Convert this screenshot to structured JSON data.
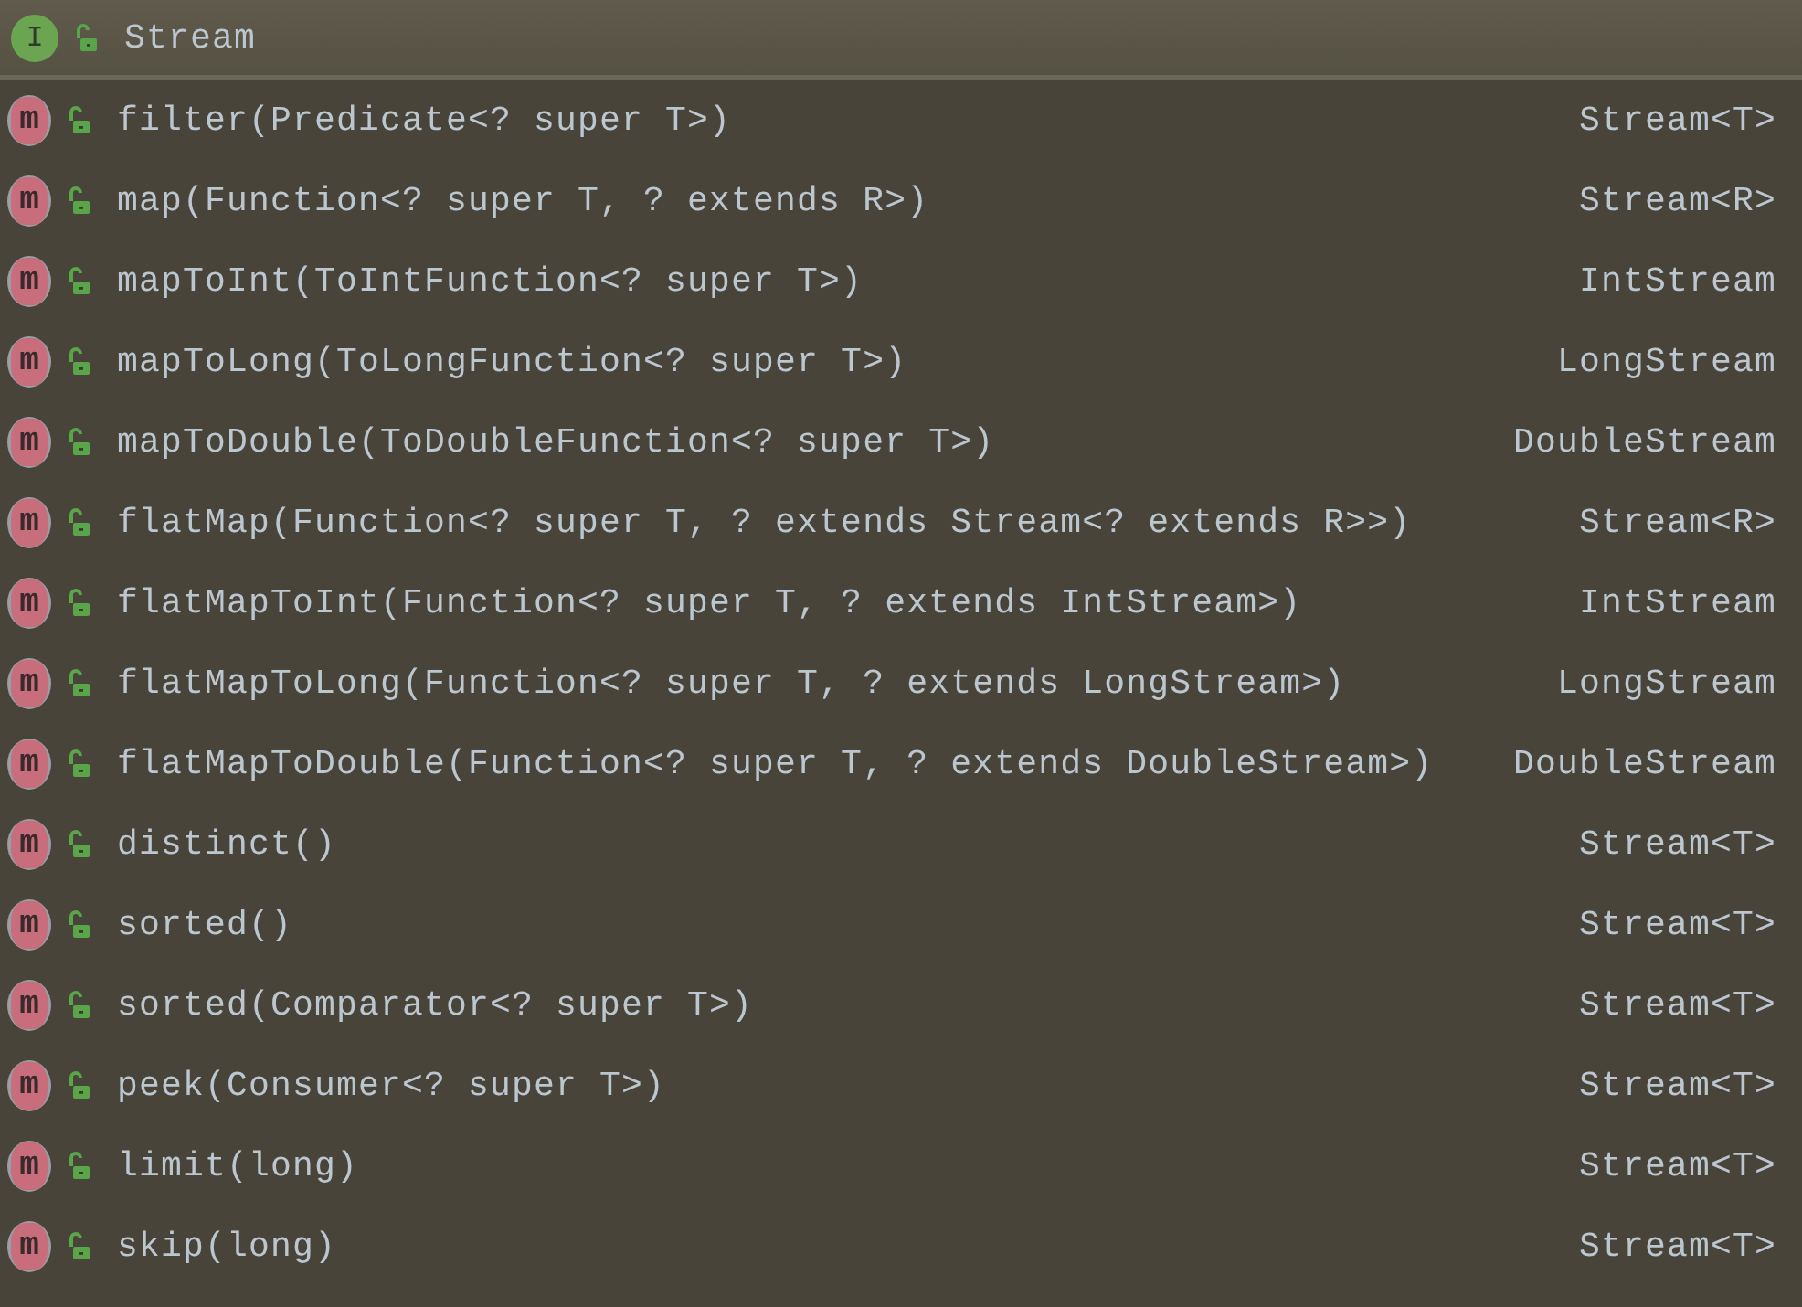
{
  "header": {
    "badge": "I",
    "title": "Stream"
  },
  "methods": [
    {
      "badge": "m",
      "signature": "filter(Predicate<? super T>)",
      "returns": "Stream<T>"
    },
    {
      "badge": "m",
      "signature": "map(Function<? super T, ? extends R>)",
      "returns": "Stream<R>"
    },
    {
      "badge": "m",
      "signature": "mapToInt(ToIntFunction<? super T>)",
      "returns": "IntStream"
    },
    {
      "badge": "m",
      "signature": "mapToLong(ToLongFunction<? super T>)",
      "returns": "LongStream"
    },
    {
      "badge": "m",
      "signature": "mapToDouble(ToDoubleFunction<? super T>)",
      "returns": "DoubleStream"
    },
    {
      "badge": "m",
      "signature": "flatMap(Function<? super T, ? extends Stream<? extends R>>)",
      "returns": "Stream<R>"
    },
    {
      "badge": "m",
      "signature": "flatMapToInt(Function<? super T, ? extends IntStream>)",
      "returns": "IntStream"
    },
    {
      "badge": "m",
      "signature": "flatMapToLong(Function<? super T, ? extends LongStream>)",
      "returns": "LongStream"
    },
    {
      "badge": "m",
      "signature": "flatMapToDouble(Function<? super T, ? extends DoubleStream>)",
      "returns": "DoubleStream"
    },
    {
      "badge": "m",
      "signature": "distinct()",
      "returns": "Stream<T>"
    },
    {
      "badge": "m",
      "signature": "sorted()",
      "returns": "Stream<T>"
    },
    {
      "badge": "m",
      "signature": "sorted(Comparator<? super T>)",
      "returns": "Stream<T>"
    },
    {
      "badge": "m",
      "signature": "peek(Consumer<? super T>)",
      "returns": "Stream<T>"
    },
    {
      "badge": "m",
      "signature": "limit(long)",
      "returns": "Stream<T>"
    },
    {
      "badge": "m",
      "signature": "skip(long)",
      "returns": "Stream<T>"
    }
  ]
}
